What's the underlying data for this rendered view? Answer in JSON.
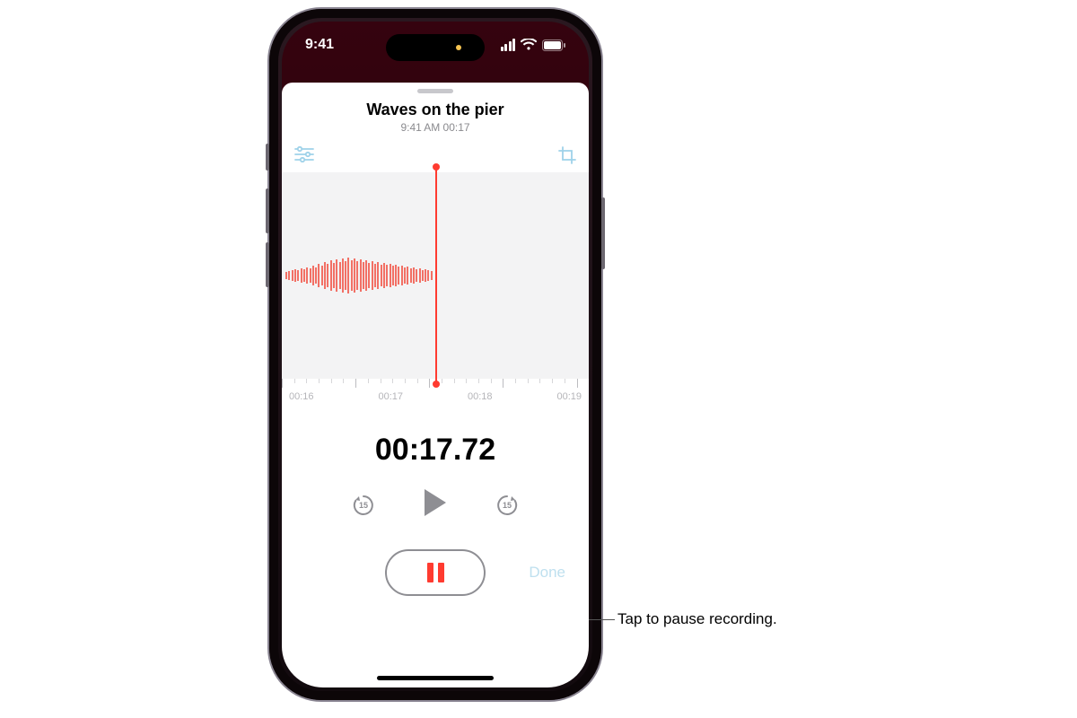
{
  "statusbar": {
    "time": "9:41"
  },
  "recording": {
    "title": "Waves on the pier",
    "subtitle": "9:41 AM  00:17",
    "timer": "00:17.72",
    "skip_seconds": "15",
    "tick_labels": [
      "00:16",
      "00:17",
      "00:18",
      "00:19"
    ],
    "done_label": "Done"
  },
  "callout": {
    "pause": "Tap to pause recording."
  },
  "colors": {
    "accent": "#ff3b30"
  }
}
